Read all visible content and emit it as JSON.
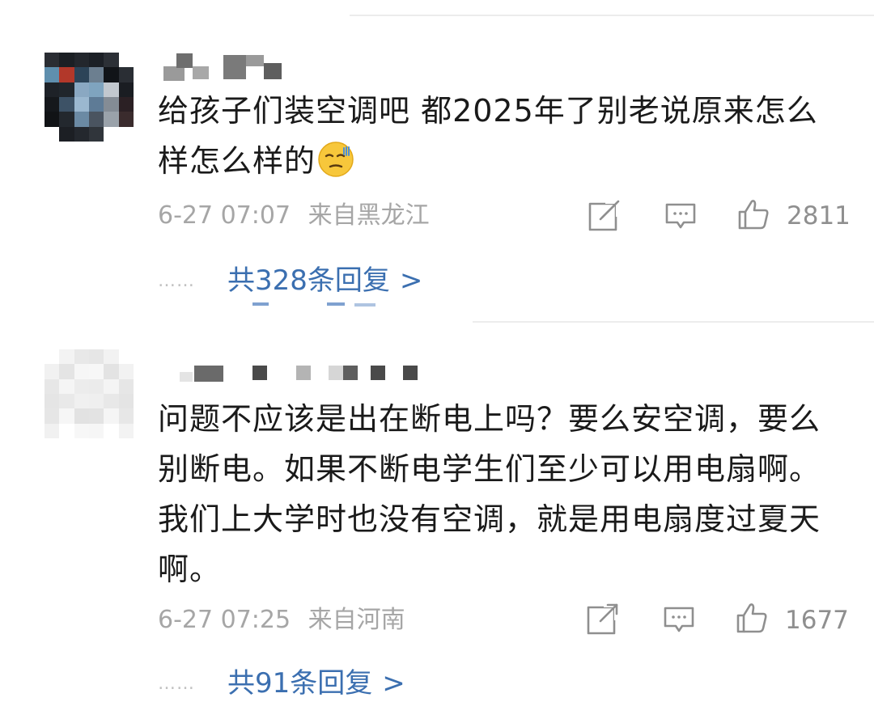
{
  "comments": [
    {
      "text": "给孩子们装空调吧 都2025年了别老说原来怎么样怎么样的",
      "emoji": "sweat-smile-emoji",
      "date": "6-27 07:07",
      "location": "来自黑龙江",
      "likes": "2811",
      "dots": "……",
      "replies": "共328条回复",
      "chevron": ">"
    },
    {
      "text": "问题不应该是出在断电上吗？要么安空调，要么别断电。如果不断电学生们至少可以用电扇啊。我们上大学时也没有空调，就是用电扇度过夏天啊。",
      "date": "6-27 07:25",
      "location": "来自河南",
      "likes": "1677",
      "dots": "……",
      "replies": "共91条回复",
      "chevron": ">"
    }
  ],
  "icons": {
    "share": "share-icon",
    "comment": "comment-icon",
    "like": "thumbs-up-icon"
  },
  "colors": {
    "text": "#1a1a1a",
    "meta": "#a6a6a6",
    "link": "#3b6fb0",
    "divider": "#ececec"
  }
}
